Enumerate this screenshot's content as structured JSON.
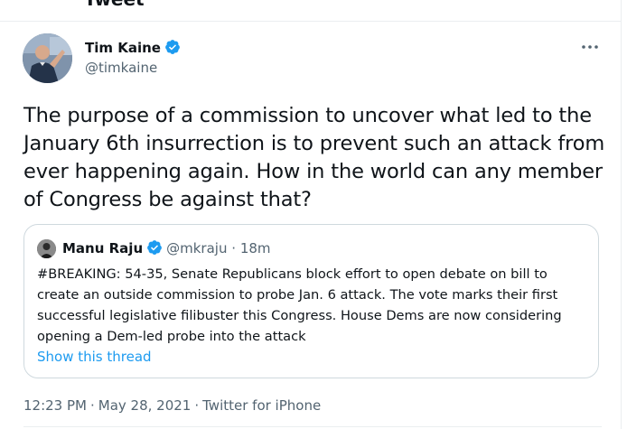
{
  "header": {
    "title": "Tweet"
  },
  "tweet": {
    "author": {
      "name": "Tim Kaine",
      "handle": "@timkaine",
      "verified": true,
      "verified_icon": "verified-badge-icon"
    },
    "more_icon": "more-dots-icon",
    "text": "The purpose of a commission to uncover what led to the January 6th insurrection is to prevent such an attack from ever happening again. How in the world can any member of Congress be against that?",
    "quoted": {
      "author": {
        "name": "Manu Raju",
        "handle": "@mkraju",
        "verified": true
      },
      "separator": "·",
      "time": "18m",
      "text": "#BREAKING: 54-35, Senate Republicans block effort to open debate on bill to create an outside commission to probe Jan. 6 attack. The vote marks their first successful legislative filibuster this Congress. House Dems are now considering opening a Dem-led probe into the attack",
      "show_thread": "Show this thread"
    },
    "meta": {
      "time": "12:23 PM",
      "separator": "·",
      "date": "May 28, 2021",
      "source": "Twitter for iPhone"
    }
  },
  "colors": {
    "accent": "#1d9bf0",
    "text_primary": "#0f1419",
    "text_secondary": "#536471",
    "border": "#cfd9de"
  }
}
